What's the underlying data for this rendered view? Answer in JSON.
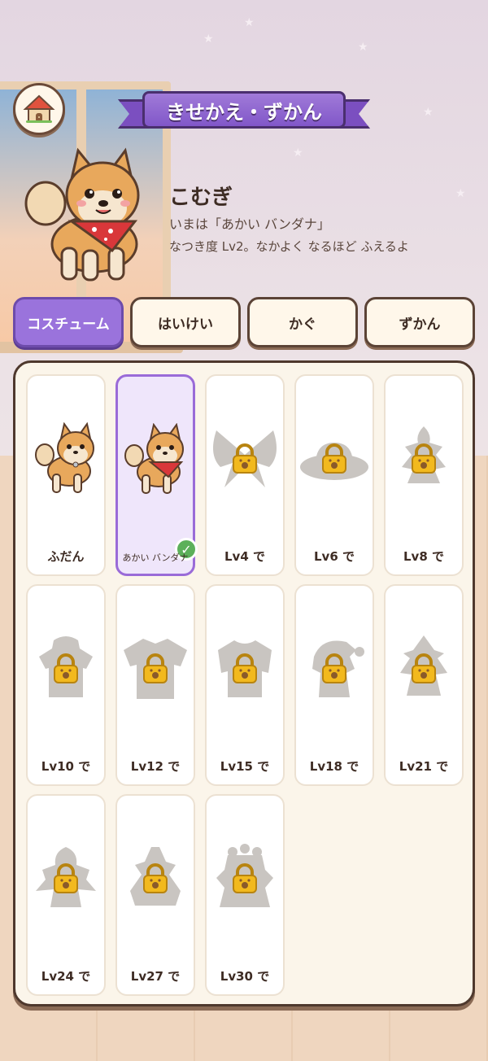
{
  "header": {
    "title": "きせかえ・ずかん"
  },
  "pet": {
    "name": "こむぎ",
    "status": "いまは「あかい バンダナ」",
    "level_text": "なつき度 Lv2。なかよく なるほど ふえるよ"
  },
  "tabs": [
    {
      "label": "コスチューム",
      "active": true
    },
    {
      "label": "はいけい",
      "active": false
    },
    {
      "label": "かぐ",
      "active": false
    },
    {
      "label": "ずかん",
      "active": false
    }
  ],
  "items": [
    {
      "label": "ふだん",
      "state": "unlocked",
      "icon": "dog-plain-icon"
    },
    {
      "label": "あかい バンダナ",
      "state": "selected",
      "icon": "dog-bandana-icon"
    },
    {
      "label": "Lv4 で",
      "state": "locked",
      "icon": "bow-silhouette-icon"
    },
    {
      "label": "Lv6 で",
      "state": "locked",
      "icon": "hat-silhouette-icon"
    },
    {
      "label": "Lv8 で",
      "state": "locked",
      "icon": "raincoat-silhouette-icon"
    },
    {
      "label": "Lv10 で",
      "state": "locked",
      "icon": "hoodie-silhouette-icon"
    },
    {
      "label": "Lv12 で",
      "state": "locked",
      "icon": "shirt-silhouette-icon"
    },
    {
      "label": "Lv15 で",
      "state": "locked",
      "icon": "sweater-silhouette-icon"
    },
    {
      "label": "Lv18 で",
      "state": "locked",
      "icon": "santa-silhouette-icon"
    },
    {
      "label": "Lv21 で",
      "state": "locked",
      "icon": "witch-silhouette-icon"
    },
    {
      "label": "Lv24 で",
      "state": "locked",
      "icon": "wizard-silhouette-icon"
    },
    {
      "label": "Lv27 で",
      "state": "locked",
      "icon": "dress-silhouette-icon"
    },
    {
      "label": "Lv30 で",
      "state": "locked",
      "icon": "crown-silhouette-icon"
    }
  ],
  "colors": {
    "accent": "#9a73dc",
    "panel": "#fbf5ea",
    "outline": "#4e382d",
    "lock": "#f2b91e",
    "check": "#5cb05a"
  }
}
